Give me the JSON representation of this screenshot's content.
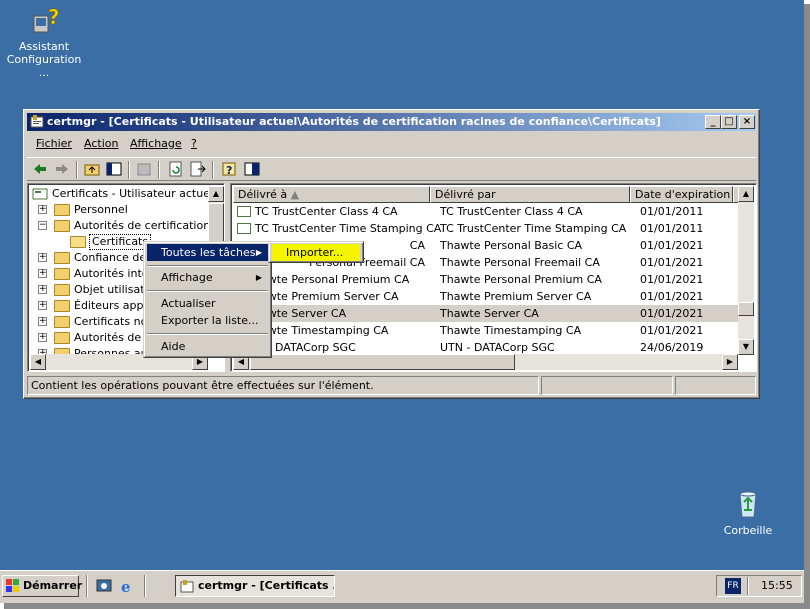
{
  "desktop": {
    "icons": [
      {
        "name": "assistant-configuration-icon",
        "label": "Assistant Configuration ..."
      },
      {
        "name": "recycle-bin-icon",
        "label": "Corbeille"
      }
    ]
  },
  "window": {
    "title": "certmgr - [Certificats - Utilisateur actuel\\Autorités de certification racines de confiance\\Certificats]",
    "min": "_",
    "max": "□",
    "close": "×"
  },
  "menu": [
    "Fichier",
    "Action",
    "Affichage",
    "?"
  ],
  "tree": {
    "root": "Certificats - Utilisateur actuel",
    "items": [
      "Personnel",
      "Autorités de certification raci",
      "Certificats",
      "Confiance de l'",
      "Autorités inter",
      "Objet utilisate",
      "Éditeurs appro",
      "Certificats non",
      "Autorités de ce",
      "Personnes aut"
    ]
  },
  "list": {
    "columns": [
      "Délivré à",
      "Délivré par",
      "Date d'expiration",
      ""
    ],
    "rows": [
      [
        "TC TrustCenter Class 4 CA",
        "TC TrustCenter Class 4 CA",
        "01/01/2011"
      ],
      [
        "TC TrustCenter Time Stamping CA",
        "TC TrustCenter Time Stamping CA",
        "01/01/2011"
      ],
      [
        "Thawte Personal Basic CA",
        "Thawte Personal Basic CA",
        "01/01/2021"
      ],
      [
        "Thawte Personal Freemail CA",
        "Thawte Personal Freemail CA",
        "01/01/2021"
      ],
      [
        "Thawte Personal Premium CA",
        "Thawte Personal Premium CA",
        "01/01/2021"
      ],
      [
        "Thawte Premium Server CA",
        "Thawte Premium Server CA",
        "01/01/2021"
      ],
      [
        "Thawte Server CA",
        "Thawte Server CA",
        "01/01/2021"
      ],
      [
        "Thawte Timestamping CA",
        "Thawte Timestamping CA",
        "01/01/2021"
      ],
      [
        "UTN - DATACorp SGC",
        "UTN - DATACorp SGC",
        "24/06/2019"
      ]
    ],
    "visible_left": [
      "TC TrustCenter Class 4 CA",
      "TC TrustCenter Time Stamping CA",
      "CA",
      "Personal Freemail CA",
      "awte Personal Premium CA",
      "awte Premium Server CA",
      "awte Server CA",
      "awte Timestamping CA",
      "l - DATACorp SGC"
    ]
  },
  "context_menu": {
    "items": [
      "Toutes les tâches",
      "Affichage",
      "Actualiser",
      "Exporter la liste...",
      "Aide"
    ]
  },
  "submenu": {
    "items": [
      "Importer..."
    ]
  },
  "status": "Contient les opérations pouvant être effectuées sur l'élément.",
  "taskbar": {
    "start": "Démarrer",
    "task": "certmgr - [Certificats ...",
    "lang": "FR",
    "clock": "15:55"
  }
}
